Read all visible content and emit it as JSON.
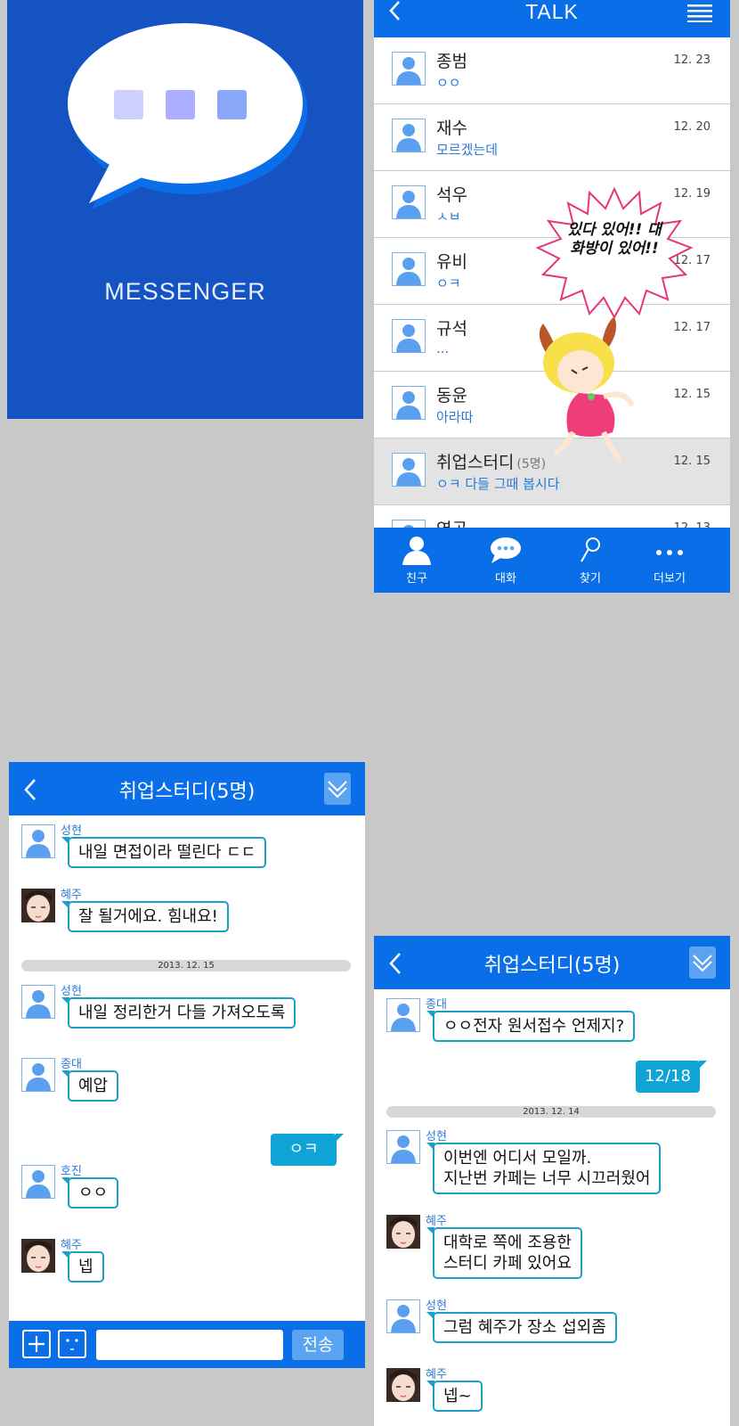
{
  "splash": {
    "title": "MESSENGER"
  },
  "talk": {
    "title": "TALK",
    "rows": [
      {
        "name": "종범",
        "message": "ㅇㅇ",
        "date": "12. 23"
      },
      {
        "name": "재수",
        "message": "모르겠는데",
        "date": "12. 20"
      },
      {
        "name": "석우",
        "message": "ㅅㅂ",
        "date": "12. 19"
      },
      {
        "name": "유비",
        "message": "ㅇㅋ",
        "date": "12. 17"
      },
      {
        "name": "규석",
        "message": "...",
        "date": "12. 17"
      },
      {
        "name": "동윤",
        "message": "아라따",
        "date": "12. 15"
      },
      {
        "name": "취업스터디",
        "count": "(5명)",
        "message": "ㅇㅋ 다들 그때 봅시다",
        "date": "12. 15"
      },
      {
        "name": "영곤",
        "message": "",
        "date": "12. 13"
      }
    ],
    "callout": "있다 있어!! 대화방이 있어!!",
    "tabs": [
      "친구",
      "대화",
      "찾기",
      "더보기"
    ]
  },
  "chat1": {
    "title": "취업스터디(5명)",
    "messages": [
      {
        "sender": "성현",
        "text": "내일 면접이라 떨린다 ㄷㄷ"
      },
      {
        "sender": "혜주",
        "text": "잘 될거에요. 힘내요!"
      },
      {
        "date": "2013. 12. 15"
      },
      {
        "sender": "성현",
        "text": "내일 정리한거 다들 가져오도록"
      },
      {
        "sender": "종대",
        "text": "예압"
      },
      {
        "mine": "ㅇㅋ"
      },
      {
        "sender": "호진",
        "text": "ㅇㅇ"
      },
      {
        "sender": "혜주",
        "text": "넵"
      }
    ],
    "send_label": "전송"
  },
  "chat2": {
    "title": "취업스터디(5명)",
    "messages": [
      {
        "sender": "종대",
        "text": "ㅇㅇ전자 원서접수 언제지?"
      },
      {
        "mine": "12/18"
      },
      {
        "date": "2013. 12. 14"
      },
      {
        "sender": "성현",
        "text1": "이번엔 어디서 모일까.",
        "text2": "지난번 카페는 너무 시끄러웠어"
      },
      {
        "sender": "혜주",
        "text1": "대학로 쪽에 조용한",
        "text2": "스터디 카페 있어요"
      },
      {
        "sender": "성현",
        "text": "그럼 혜주가 장소 섭외좀"
      },
      {
        "sender": "혜주",
        "text": "넵~"
      }
    ]
  },
  "colors": {
    "brand": "#0a6ee8",
    "splash": "#1552c2",
    "bubble_border": "#1aa0c8",
    "mine_bubble": "#10a3d6"
  }
}
